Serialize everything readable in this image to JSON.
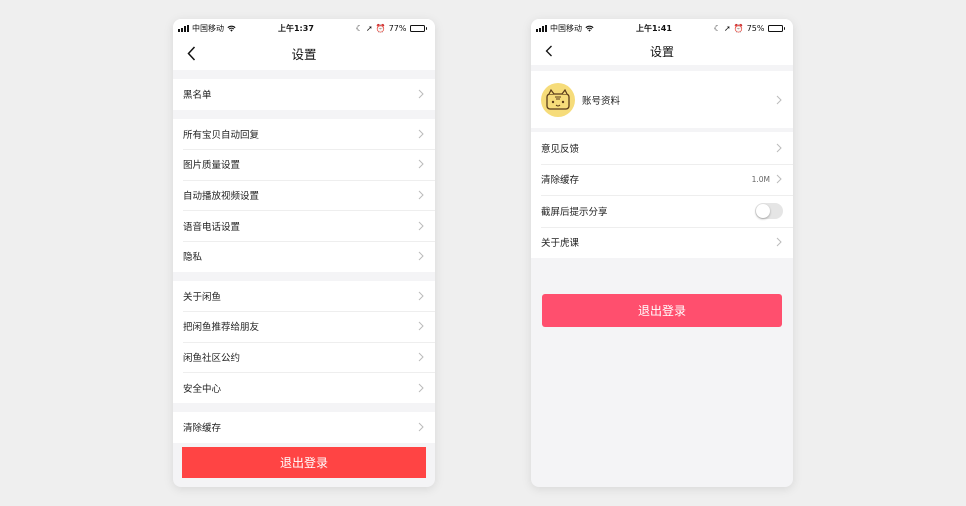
{
  "phone1": {
    "status": {
      "carrier": "中国移动",
      "time": "上午1:37",
      "battery": "77%",
      "battery_level": 0.77
    },
    "title": "设置",
    "groups": [
      [
        "黑名单"
      ],
      [
        "所有宝贝自动回复",
        "图片质量设置",
        "自动播放视频设置",
        "语音电话设置",
        "隐私"
      ],
      [
        "关于闲鱼",
        "把闲鱼推荐给朋友",
        "闲鱼社区公约",
        "安全中心"
      ],
      [
        "清除缓存"
      ]
    ],
    "logout": "退出登录",
    "colors": {
      "logout": "#ff4444"
    }
  },
  "phone2": {
    "status": {
      "carrier": "中国移动",
      "time": "上午1:41",
      "battery": "75%",
      "battery_level": 0.75
    },
    "title": "设置",
    "profile_label": "账号资料",
    "items": {
      "feedback": "意见反馈",
      "clear_cache": "清除缓存",
      "cache_size": "1.0M",
      "screenshot_share": "截屏后提示分享",
      "screenshot_share_on": false,
      "about": "关于虎课"
    },
    "logout": "退出登录",
    "colors": {
      "logout": "#ff4f6e",
      "avatar_bg": "#f6dc7a"
    }
  }
}
